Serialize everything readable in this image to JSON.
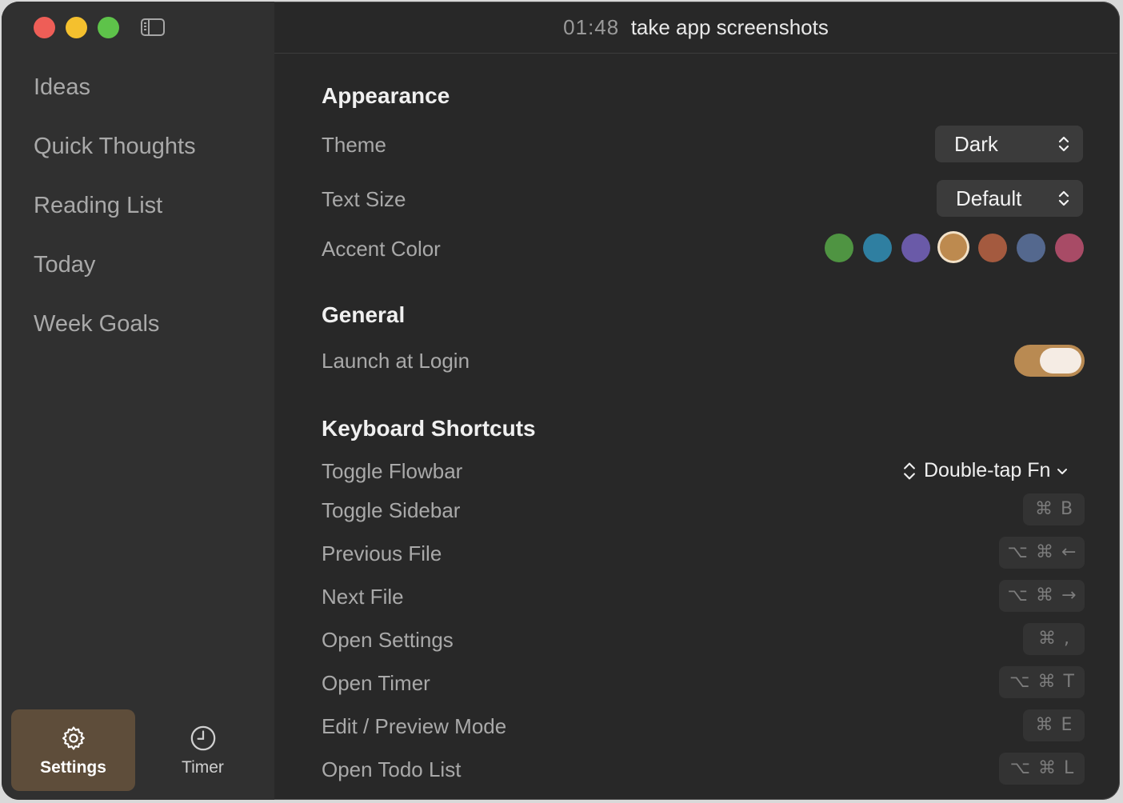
{
  "window": {
    "time": "01:48",
    "title": "take app screenshots"
  },
  "sidebar": {
    "items": [
      {
        "label": "Ideas"
      },
      {
        "label": "Quick Thoughts"
      },
      {
        "label": "Reading List"
      },
      {
        "label": "Today"
      },
      {
        "label": "Week Goals"
      }
    ],
    "bottom_tabs": [
      {
        "label": "Settings",
        "icon": "gear-icon",
        "active": true
      },
      {
        "label": "Timer",
        "icon": "clock-icon",
        "active": false
      }
    ]
  },
  "settings": {
    "appearance": {
      "heading": "Appearance",
      "theme_label": "Theme",
      "theme_value": "Dark",
      "text_size_label": "Text Size",
      "text_size_value": "Default",
      "accent_label": "Accent Color",
      "accent_colors": [
        "#4f9442",
        "#2f7fa1",
        "#6a5aa8",
        "#bd8a4f",
        "#a45a3f",
        "#54688e",
        "#a84b66"
      ],
      "accent_selected": "#bd8a4f"
    },
    "general": {
      "heading": "General",
      "launch_label": "Launch at Login",
      "launch_enabled": true
    },
    "shortcuts": {
      "heading": "Keyboard Shortcuts",
      "flowbar_label": "Toggle Flowbar",
      "flowbar_value": "Double-tap Fn",
      "items": [
        {
          "label": "Toggle Sidebar",
          "keys": [
            "⌘",
            "B"
          ]
        },
        {
          "label": "Previous File",
          "keys": [
            "⌥",
            "⌘",
            "←"
          ]
        },
        {
          "label": "Next File",
          "keys": [
            "⌥",
            "⌘",
            "→"
          ]
        },
        {
          "label": "Open Settings",
          "keys": [
            "⌘",
            ","
          ]
        },
        {
          "label": "Open Timer",
          "keys": [
            "⌥",
            "⌘",
            "T"
          ]
        },
        {
          "label": "Edit / Preview Mode",
          "keys": [
            "⌘",
            "E"
          ]
        },
        {
          "label": "Open Todo List",
          "keys": [
            "⌥",
            "⌘",
            "L"
          ]
        }
      ]
    }
  }
}
